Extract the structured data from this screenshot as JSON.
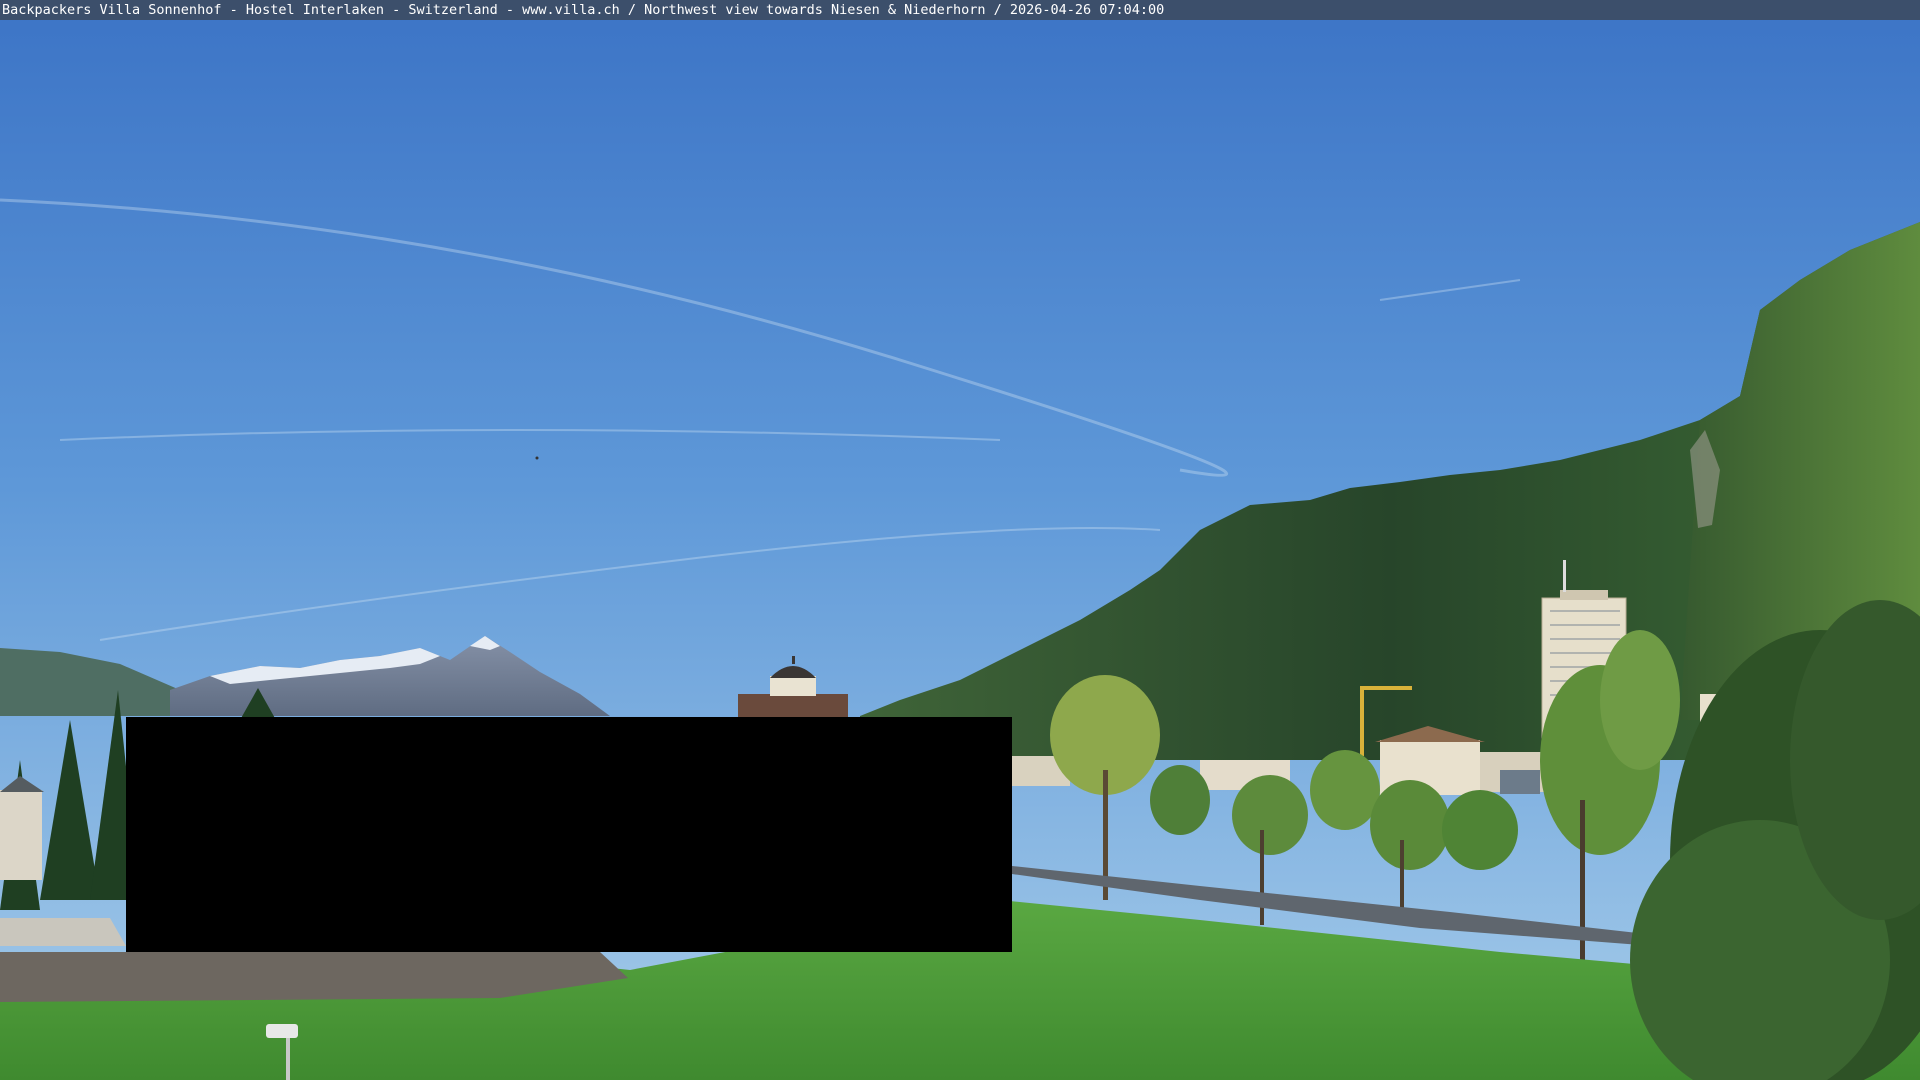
{
  "caption": "Backpackers Villa Sonnenhof - Hostel Interlaken - Switzerland - www.villa.ch / Northwest view towards Niesen & Niederhorn / 2026-04-26 07:04:00",
  "colors": {
    "caption_bar": "#3c4f6b",
    "sky_top": "#3f78c8",
    "sky_horizon": "#9cc7ea",
    "mountain_forest": "#2d4a2a",
    "meadow": "#4f9b3a",
    "privacy_mask": "#000000"
  }
}
